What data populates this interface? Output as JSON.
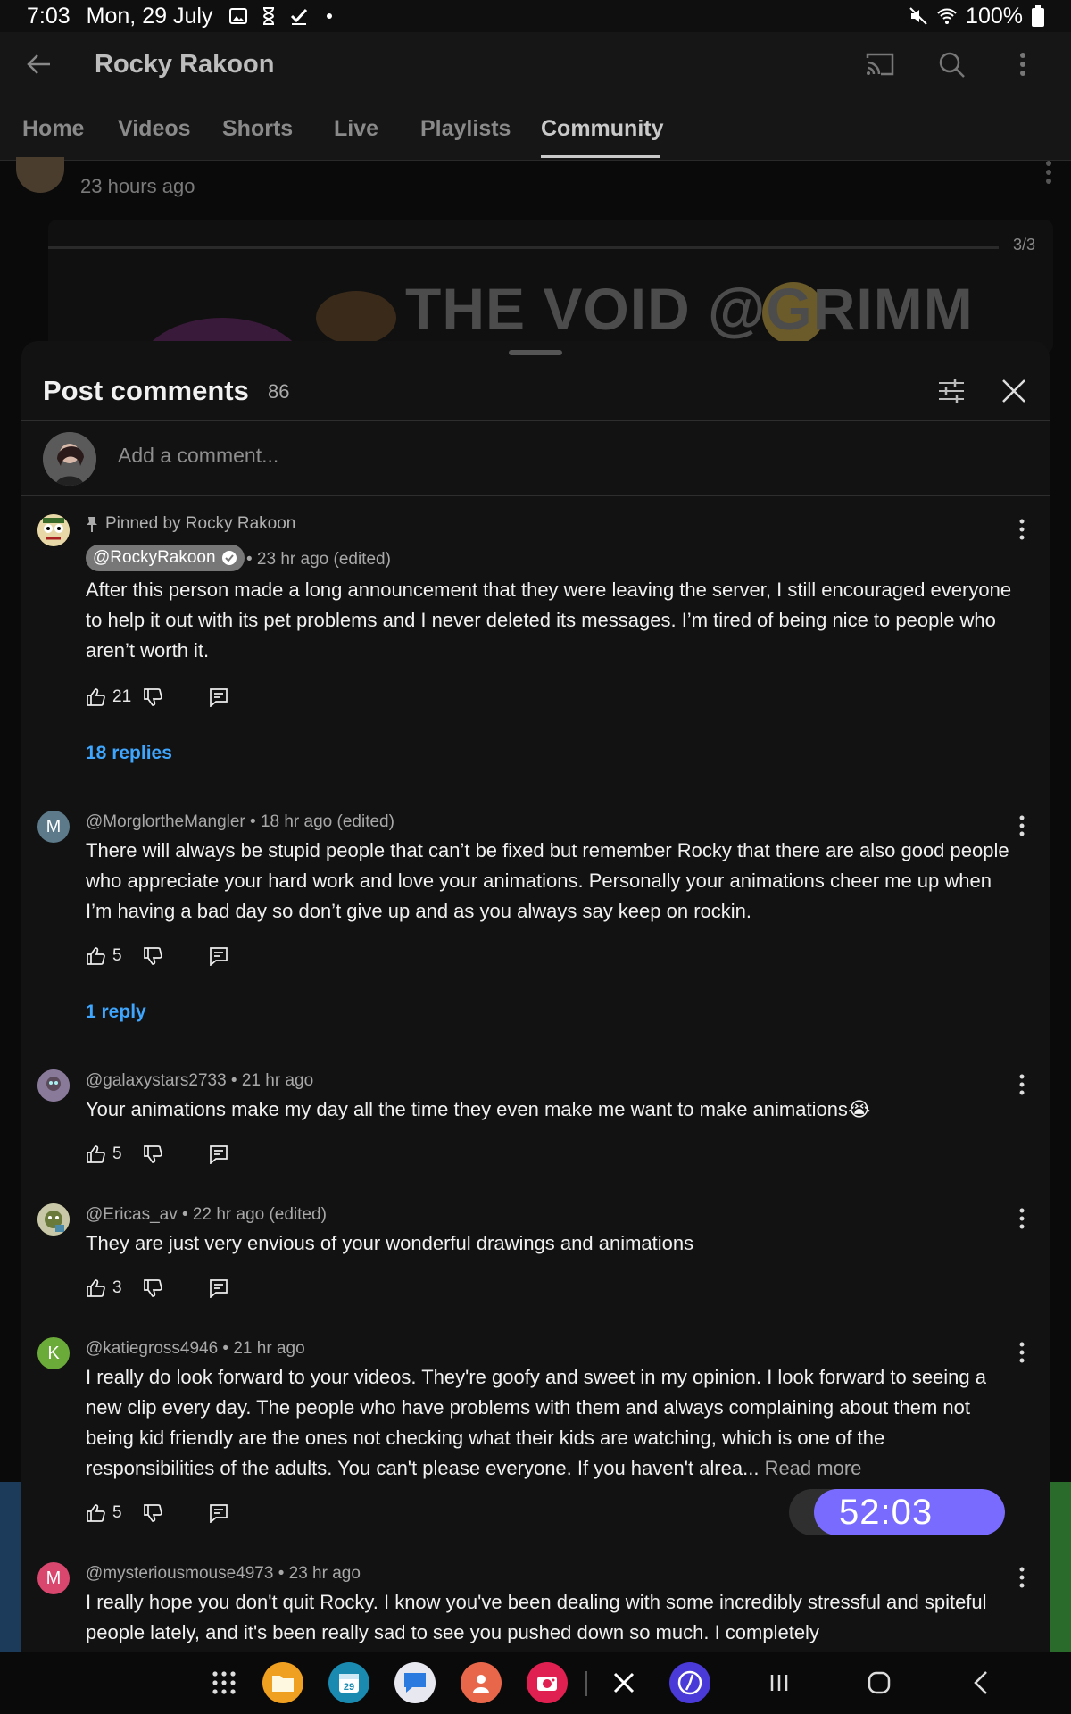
{
  "status_bar": {
    "time": "7:03",
    "date": "Mon, 29 July",
    "battery": "100%"
  },
  "header": {
    "title": "Rocky Rakoon"
  },
  "tabs": [
    {
      "label": "Home"
    },
    {
      "label": "Videos"
    },
    {
      "label": "Shorts"
    },
    {
      "label": "Live"
    },
    {
      "label": "Playlists"
    },
    {
      "label": "Community"
    }
  ],
  "active_tab": "Community",
  "background_post": {
    "time": "23 hours ago",
    "image_counter": "3/3",
    "banner_text": "THE VOID  @GRIMM"
  },
  "comments_sheet": {
    "title": "Post comments",
    "count": "86",
    "add_placeholder": "Add a comment..."
  },
  "comments": [
    {
      "pinned_label": "Pinned by Rocky Rakoon",
      "author": "@RockyRakoon",
      "meta": "• 23 hr ago (edited)",
      "text": "After this person made a long announcement that they were leaving the server, I still encouraged everyone to help it out with its pet problems and I never deleted its messages. I’m tired of being nice to people who aren’t worth it.",
      "likes": "21",
      "replies": "18 replies"
    },
    {
      "avatar_letter": "M",
      "avatar_color": "#5c7a8a",
      "meta": "@MorglortheMangler • 18 hr ago (edited)",
      "text": "There will always be stupid people that can’t be fixed but remember Rocky that there are also good people who appreciate your hard work and love your animations.  Personally your animations cheer me up when I’m having a bad day so don’t give up and as you always say keep on rockin.",
      "likes": "5",
      "replies": "1 reply"
    },
    {
      "meta": "@galaxystars2733 • 21 hr ago",
      "text": "Your animations make my day all the time they even make me want to make animations😭",
      "likes": "5"
    },
    {
      "meta": "@Ericas_av • 22 hr ago (edited)",
      "text": "They are just very envious of your wonderful drawings and animations",
      "likes": "3"
    },
    {
      "avatar_letter": "K",
      "avatar_color": "#6bab3a",
      "meta": "@katiegross4946 • 21 hr ago",
      "text": "I really do look forward to your videos. They're goofy and sweet in my opinion. I look forward to seeing a new clip every day. The people who have problems with them and always complaining about them not being kid friendly are the ones not checking what their kids are watching, which is one of the responsibilities of the adults. You can't please everyone. If you haven't alrea...",
      "read_more": "Read more",
      "likes": "5"
    },
    {
      "avatar_letter": "M",
      "avatar_color": "#d9466e",
      "meta": "@mysteriousmouse4973 • 23 hr ago",
      "text": "I really hope you don't quit Rocky. I know you've been dealing with some incredibly stressful and spiteful people lately, and it's been really sad to see you pushed down so much. I completely"
    }
  ],
  "timer": {
    "value": "52:03"
  },
  "colors": {
    "accent_blue": "#3ea6ff",
    "timer_purple": "#7a6bff",
    "sheet_bg": "#121212"
  }
}
